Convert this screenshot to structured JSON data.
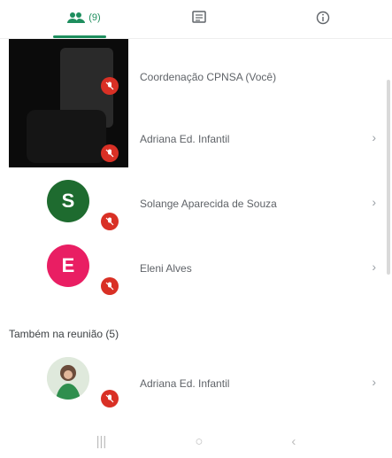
{
  "tabs": {
    "people_count": "(9)",
    "people_icon": "people-icon",
    "chat_icon": "chat-icon",
    "info_icon": "info-icon",
    "accent": "#1e8e5e"
  },
  "participants": [
    {
      "name": "Coordenação CPNSA (Você)",
      "muted": true,
      "chevron": ""
    },
    {
      "name": "Adriana Ed. Infantil",
      "muted": true,
      "chevron": "›"
    },
    {
      "name": "Solange Aparecida de Souza",
      "initial": "S",
      "color": "#1e6b2f",
      "muted": true,
      "chevron": "›"
    },
    {
      "name": "Eleni Alves",
      "initial": "E",
      "color": "#e91e63",
      "muted": true,
      "chevron": "›"
    }
  ],
  "section": {
    "title": "Também na reunião (5)"
  },
  "also_in_meeting": [
    {
      "name": "Adriana Ed. Infantil",
      "muted": true,
      "chevron": "›"
    }
  ],
  "navbar": {
    "recent": "|||",
    "home": "○",
    "back": "‹"
  },
  "colors": {
    "mute_badge": "#d93025"
  }
}
